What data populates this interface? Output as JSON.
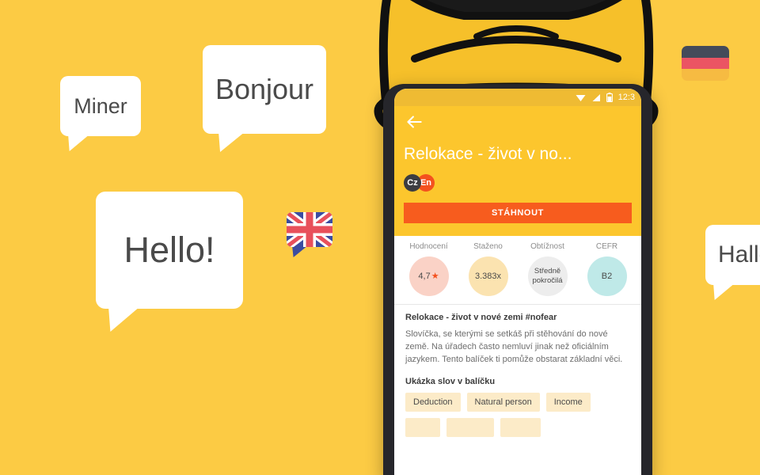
{
  "background": {
    "color": "#FCCB44"
  },
  "scene": {
    "illustration": {
      "name": "miner-helmet",
      "alt": "Miner helmet illustration"
    },
    "bubbles": [
      {
        "id": "miner",
        "text": "Miner",
        "type": "text"
      },
      {
        "id": "bonjour",
        "text": "Bonjour",
        "type": "text"
      },
      {
        "id": "hello",
        "text": "Hello!",
        "type": "text"
      },
      {
        "id": "hallo",
        "text": "Hallo",
        "type": "text"
      }
    ],
    "flags": [
      {
        "id": "uk",
        "name": "union-jack-flag",
        "label": "United Kingdom"
      },
      {
        "id": "de",
        "name": "germany-flag",
        "label": "Germany",
        "colors": [
          "#444B5A",
          "#EB5463",
          "#F6BB42"
        ]
      }
    ]
  },
  "phone": {
    "statusbar": {
      "time": "12:3",
      "icons": [
        "wifi-icon",
        "signal-icon",
        "battery-icon"
      ]
    },
    "header": {
      "back_label": "back-arrow",
      "title": "Relokace - život v no...",
      "languages": [
        {
          "code": "Cz",
          "color": "#3C3C41"
        },
        {
          "code": "En",
          "color": "#F4511E"
        }
      ],
      "download_button": "STÁHNOUT",
      "accent": "#F75C1E",
      "bg": "#FCC62D"
    },
    "stats": [
      {
        "label": "Hodnocení",
        "value": "4,7",
        "star": "★",
        "color": "#FAD2C6"
      },
      {
        "label": "Staženo",
        "value": "3.383x",
        "color": "#FBE3B0"
      },
      {
        "label": "Obtížnost",
        "value": "Středně pokročilá",
        "color": "#EDEDED"
      },
      {
        "label": "CEFR",
        "value": "B2",
        "color": "#BFE9E8"
      }
    ],
    "content": {
      "package_title": "Relokace - život v nové zemi #nofear",
      "description": "Slovíčka, se kterými se setkáš při stěhování do nové země. Na úřadech často nemluví jinak než oficiálním jazykem. Tento balíček ti pomůže obstarat základní věci.",
      "chips_title": "Ukázka slov v balíčku",
      "chips": [
        "Deduction",
        "Natural person",
        "Income"
      ]
    }
  }
}
